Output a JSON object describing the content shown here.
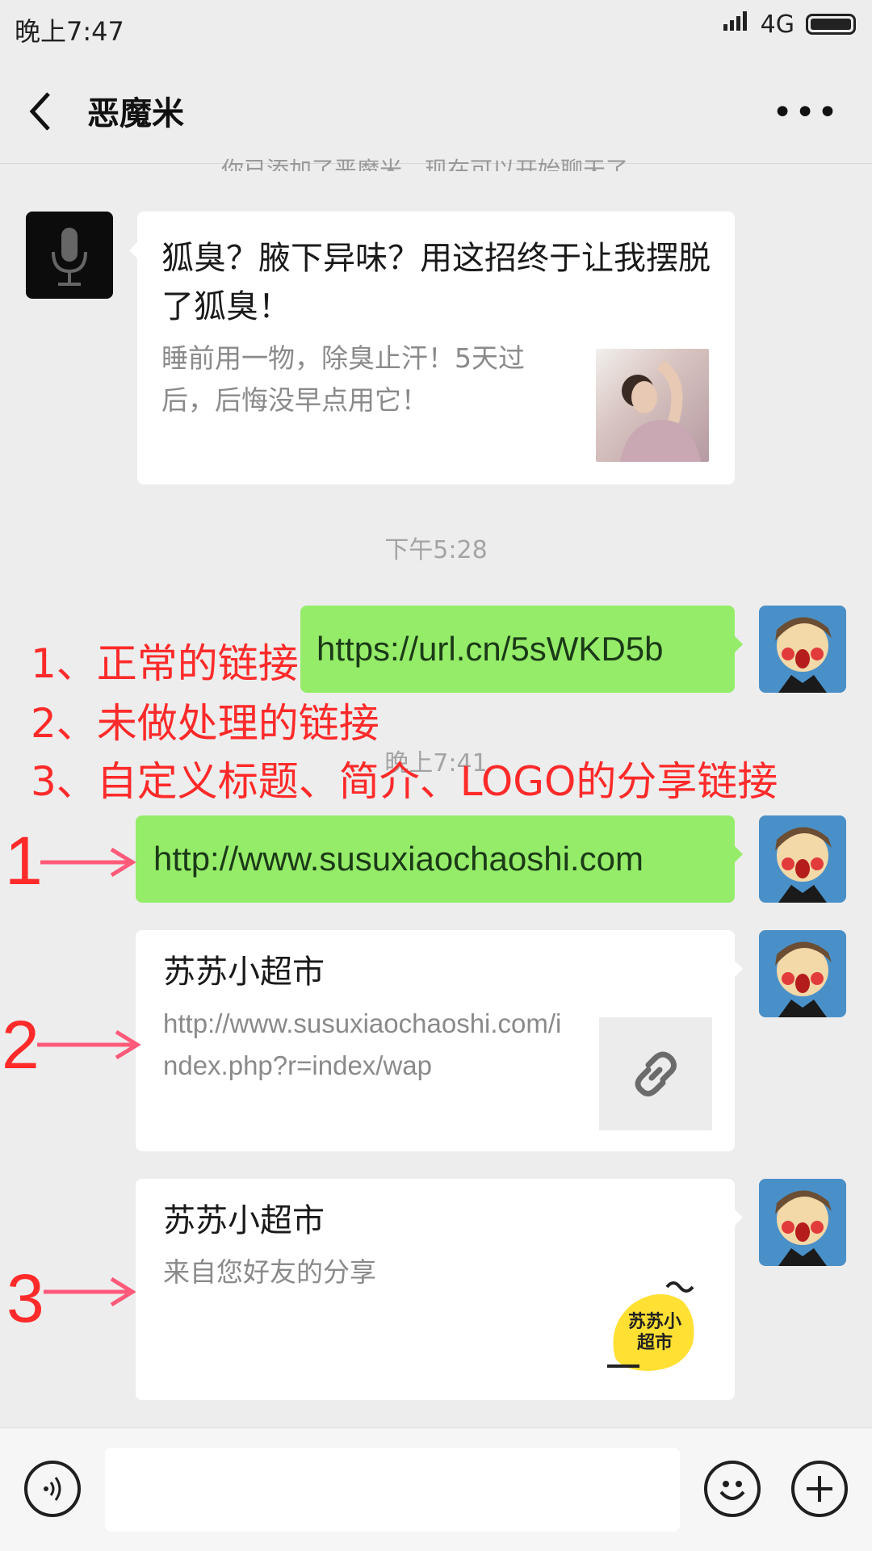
{
  "status": {
    "time": "晚上7:47",
    "network": "4G"
  },
  "header": {
    "title": "恶魔米"
  },
  "system_notice": "你已添加了恶魔米，现在可以开始聊天了。",
  "messages": {
    "article": {
      "title": "狐臭？腋下异味？用这招终于让我摆脱了狐臭！",
      "desc": "睡前用一物，除臭止汗！5天过后，后悔没早点用它！"
    },
    "time1": "下午5:28",
    "link_normal": "https://url.cn/5sWKD5b",
    "time2": "晚上7:41",
    "link_raw": "http://www.susuxiaochaoshi.com",
    "card2": {
      "title": "苏苏小超市",
      "desc": "http://www.susuxiaochaoshi.com/index.php?r=index/wap"
    },
    "card3": {
      "title": "苏苏小超市",
      "desc": "来自您好友的分享"
    },
    "logo_text": "苏苏小超市"
  },
  "annotations": {
    "line1": "1、正常的链接",
    "line2": "2、未做处理的链接",
    "line3": "3、自定义标题、简介、LOGO的分享链接",
    "n1": "1",
    "n2": "2",
    "n3": "3"
  },
  "colors": {
    "bubble": "#95ec69",
    "annotation": "#ff2a2a"
  },
  "icons": [
    "back-icon",
    "more-icon",
    "mic-icon",
    "link-icon",
    "voice-icon",
    "emoji-icon",
    "plus-icon"
  ]
}
